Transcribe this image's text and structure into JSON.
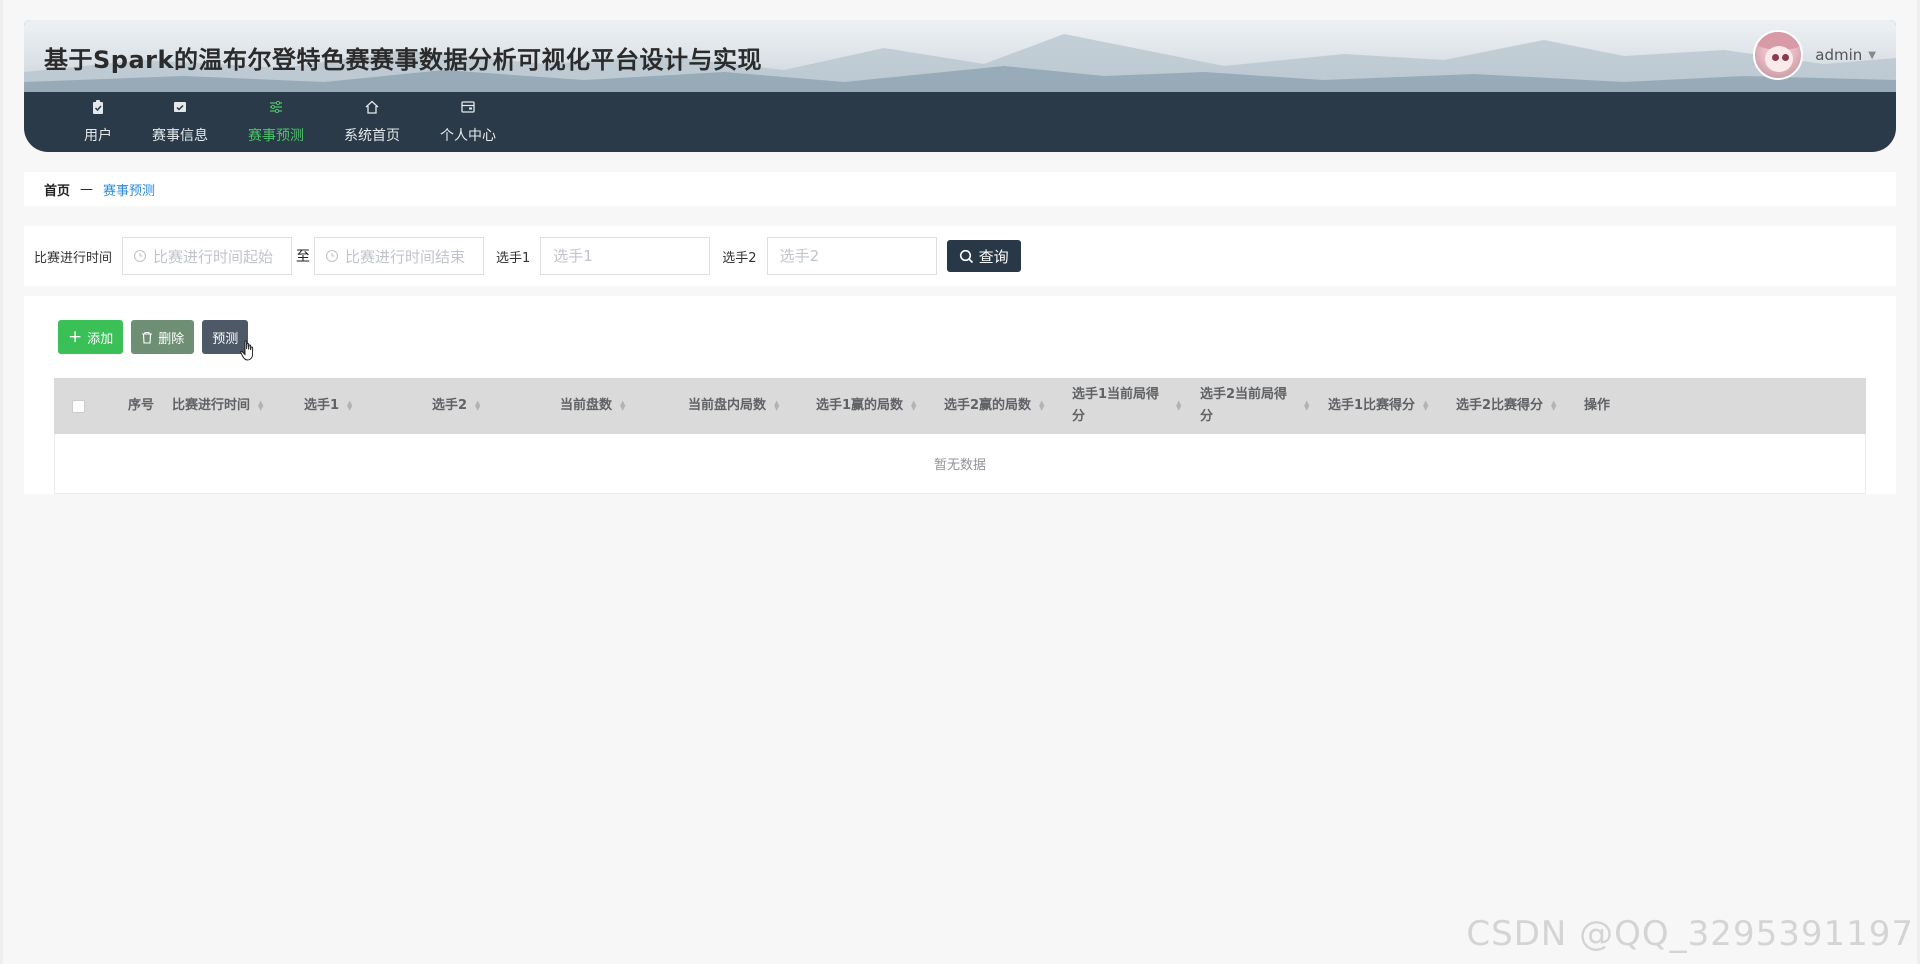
{
  "header": {
    "title": "基于Spark的温布尔登特色赛赛事数据分析可视化平台设计与实现",
    "user_name": "admin",
    "nav": [
      {
        "label": "用户",
        "icon": "clipboard-icon",
        "active": false
      },
      {
        "label": "赛事信息",
        "icon": "mail-icon",
        "active": false
      },
      {
        "label": "赛事预测",
        "icon": "sliders-icon",
        "active": true
      },
      {
        "label": "系统首页",
        "icon": "home-icon",
        "active": false
      },
      {
        "label": "个人中心",
        "icon": "wallet-icon",
        "active": false
      }
    ]
  },
  "breadcrumb": {
    "home": "首页",
    "separator": "—",
    "current": "赛事预测"
  },
  "search": {
    "time_label": "比赛进行时间",
    "time_start_placeholder": "比赛进行时间起始",
    "range_separator": "至",
    "time_end_placeholder": "比赛进行时间结束",
    "player1_label": "选手1",
    "player1_placeholder": "选手1",
    "player2_label": "选手2",
    "player2_placeholder": "选手2",
    "query_label": "查询"
  },
  "actions": {
    "add_label": "添加",
    "delete_label": "删除",
    "predict_label": "预测"
  },
  "table": {
    "columns": [
      {
        "label": "序号",
        "sortable": false
      },
      {
        "label": "比赛进行时间",
        "sortable": true
      },
      {
        "label": "选手1",
        "sortable": true
      },
      {
        "label": "选手2",
        "sortable": true
      },
      {
        "label": "当前盘数",
        "sortable": true
      },
      {
        "label": "当前盘内局数",
        "sortable": true
      },
      {
        "label": "选手1赢的局数",
        "sortable": true
      },
      {
        "label": "选手2赢的局数",
        "sortable": true
      },
      {
        "label": "选手1当前局得分",
        "sortable": true
      },
      {
        "label": "选手2当前局得分",
        "sortable": true
      },
      {
        "label": "选手1比赛得分",
        "sortable": true
      },
      {
        "label": "选手2比赛得分",
        "sortable": true
      },
      {
        "label": "操作",
        "sortable": false
      }
    ],
    "empty_text": "暂无数据"
  },
  "watermark": "CSDN @QQ_3295391197",
  "colors": {
    "nav_bg": "#2a3a48",
    "nav_active": "#4cc36a",
    "add_button": "#3bbf57",
    "delete_button": "#6f8f74",
    "predict_button": "#4d5966",
    "query_button": "#283847",
    "breadcrumb_current": "#2c8ad6"
  }
}
